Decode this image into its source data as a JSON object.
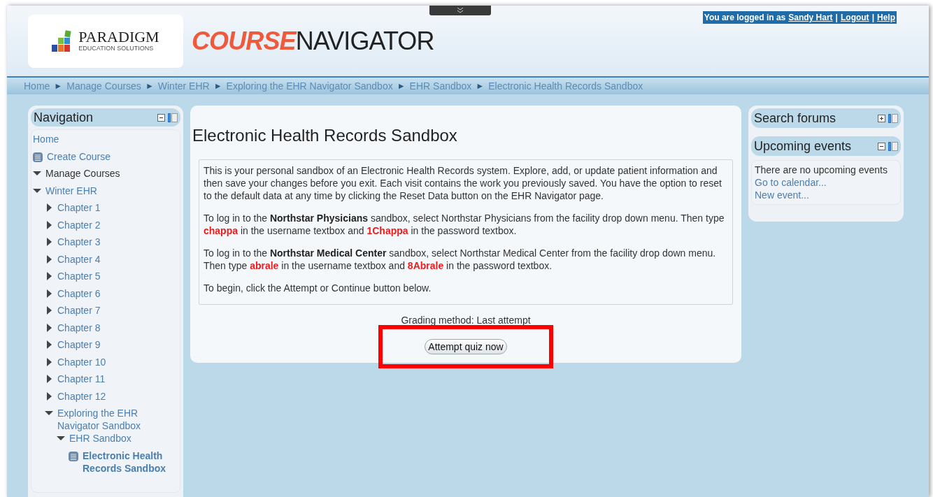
{
  "header": {
    "logo_name": "PARADIGM",
    "logo_tagline": "EDUCATION SOLUTIONS",
    "title_bold": "COURSE",
    "title_light": "NAVIGATOR",
    "login_text": "You are logged in as",
    "user": "Sandy Hart",
    "separator_1": "|",
    "logout": "Logout",
    "separator_2": "|",
    "help": "Help"
  },
  "breadcrumb": [
    "Home",
    "Manage Courses",
    "Winter EHR",
    "Exploring the EHR Navigator Sandbox",
    "EHR Sandbox",
    "Electronic Health Records Sandbox"
  ],
  "breadcrumb_separator": "►",
  "navigation": {
    "title": "Navigation",
    "collapsed": false,
    "items": [
      {
        "label": "Home",
        "kind": "link"
      },
      {
        "label": "Create Course",
        "kind": "page"
      },
      {
        "label": "Manage Courses",
        "kind": "category",
        "expanded": true
      },
      {
        "label": "Winter EHR",
        "kind": "branch",
        "expanded": true,
        "children": [
          {
            "label": "Chapter 1",
            "kind": "branch",
            "expanded": false
          },
          {
            "label": "Chapter 2",
            "kind": "branch",
            "expanded": false
          },
          {
            "label": "Chapter 3",
            "kind": "branch",
            "expanded": false
          },
          {
            "label": "Chapter 4",
            "kind": "branch",
            "expanded": false
          },
          {
            "label": "Chapter 5",
            "kind": "branch",
            "expanded": false
          },
          {
            "label": "Chapter 6",
            "kind": "branch",
            "expanded": false
          },
          {
            "label": "Chapter 7",
            "kind": "branch",
            "expanded": false
          },
          {
            "label": "Chapter 8",
            "kind": "branch",
            "expanded": false
          },
          {
            "label": "Chapter 9",
            "kind": "branch",
            "expanded": false
          },
          {
            "label": "Chapter 10",
            "kind": "branch",
            "expanded": false
          },
          {
            "label": "Chapter 11",
            "kind": "branch",
            "expanded": false
          },
          {
            "label": "Chapter 12",
            "kind": "branch",
            "expanded": false
          },
          {
            "label": "Exploring the EHR Navigator Sandbox",
            "kind": "branch",
            "expanded": true,
            "children": [
              {
                "label": "EHR Sandbox",
                "kind": "branch",
                "expanded": true,
                "children": [
                  {
                    "label": "Electronic Health Records Sandbox",
                    "kind": "current"
                  }
                ]
              }
            ]
          }
        ]
      }
    ]
  },
  "main": {
    "title": "Electronic Health Records Sandbox",
    "paragraphs": [
      [
        {
          "text": "This is your personal sandbox of an Electronic Health Records system. Explore, add, or update patient information and then save your changes before you exit. Each visit contains the work you previously saved. You have the option to reset to the default data at any time by clicking the Reset Data button on the EHR Navigator page.",
          "kind": "text"
        }
      ],
      [
        {
          "text": "To log in to the ",
          "kind": "text"
        },
        {
          "text": "Northstar Physicians",
          "kind": "name"
        },
        {
          "text": " sandbox, select Northstar Physicians from the facility drop down menu. Then type ",
          "kind": "text"
        },
        {
          "text": "chappa",
          "kind": "credential"
        },
        {
          "text": " in the username textbox and ",
          "kind": "text"
        },
        {
          "text": "1Chappa",
          "kind": "credential"
        },
        {
          "text": " in the password textbox.",
          "kind": "text"
        }
      ],
      [
        {
          "text": "To log in to the ",
          "kind": "text"
        },
        {
          "text": "Northstar Medical Center",
          "kind": "name"
        },
        {
          "text": " sandbox, select Northstar Medical Center from the facility drop down menu. Then type ",
          "kind": "text"
        },
        {
          "text": "abrale",
          "kind": "credential"
        },
        {
          "text": " in the username textbox and ",
          "kind": "text"
        },
        {
          "text": "8Abrale",
          "kind": "credential"
        },
        {
          "text": " in the password textbox.",
          "kind": "text"
        }
      ],
      [
        {
          "text": "To begin, click the Attempt or Continue button below.",
          "kind": "text"
        }
      ]
    ],
    "grading": "Grading method: Last attempt",
    "button": "Attempt quiz now",
    "highlighted": true
  },
  "search_forums": {
    "title": "Search forums",
    "collapsed": true
  },
  "upcoming_events": {
    "title": "Upcoming events",
    "collapsed": false,
    "message": "There are no upcoming events",
    "links": [
      "Go to calendar...",
      "New event..."
    ]
  }
}
